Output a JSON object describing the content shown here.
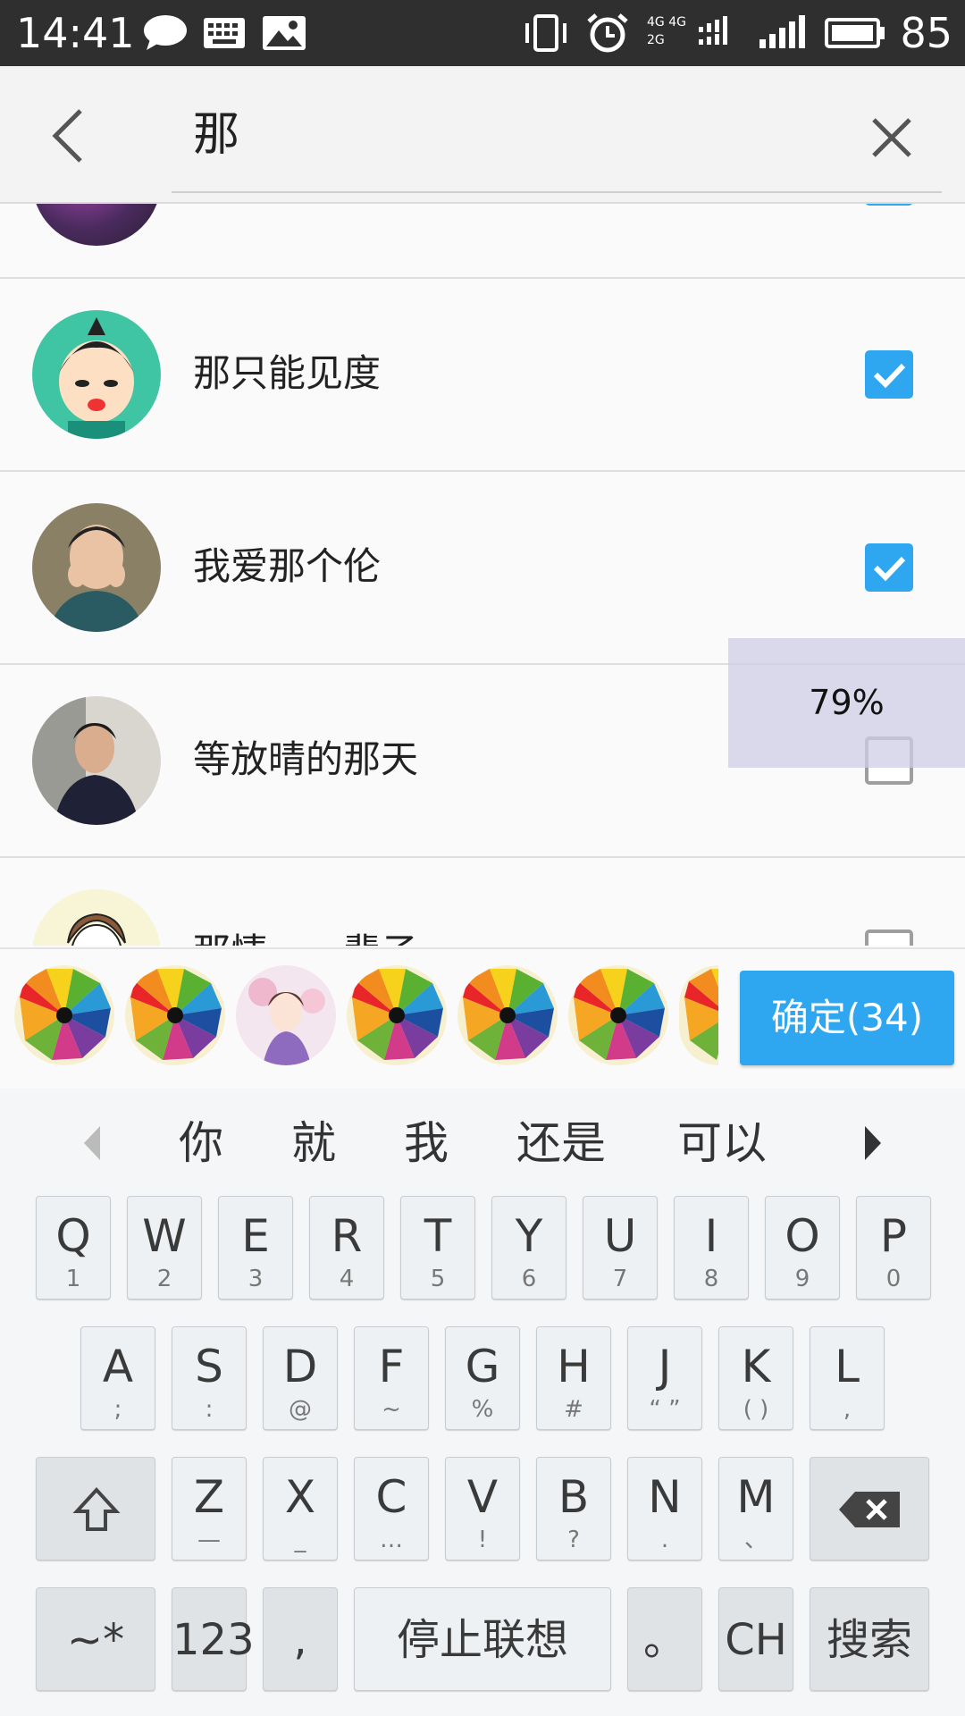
{
  "status_bar": {
    "time": "14:41",
    "network_top": "4G 4G",
    "network_bottom": "2G",
    "battery": "85"
  },
  "search": {
    "query": "那"
  },
  "contacts": [
    {
      "name": "",
      "checked": true
    },
    {
      "name": "那只能见度",
      "checked": true
    },
    {
      "name": "我爱那个伦",
      "checked": true
    },
    {
      "name": "等放晴的那天",
      "checked": false
    },
    {
      "name": "那情……辈子",
      "checked": false
    }
  ],
  "scroll_overlay": {
    "text": "79%"
  },
  "selected": {
    "confirm_label": "确定(34)"
  },
  "keyboard": {
    "candidates": [
      "你",
      "就",
      "我",
      "还是",
      "可以"
    ],
    "row1": [
      {
        "main": "Q",
        "sub": "1"
      },
      {
        "main": "W",
        "sub": "2"
      },
      {
        "main": "E",
        "sub": "3"
      },
      {
        "main": "R",
        "sub": "4"
      },
      {
        "main": "T",
        "sub": "5"
      },
      {
        "main": "Y",
        "sub": "6"
      },
      {
        "main": "U",
        "sub": "7"
      },
      {
        "main": "I",
        "sub": "8"
      },
      {
        "main": "O",
        "sub": "9"
      },
      {
        "main": "P",
        "sub": "0"
      }
    ],
    "row2": [
      {
        "main": "A",
        "sub": ";"
      },
      {
        "main": "S",
        "sub": ":"
      },
      {
        "main": "D",
        "sub": "@"
      },
      {
        "main": "F",
        "sub": "~"
      },
      {
        "main": "G",
        "sub": "%"
      },
      {
        "main": "H",
        "sub": "#"
      },
      {
        "main": "J",
        "sub": "“ ”"
      },
      {
        "main": "K",
        "sub": "( )"
      },
      {
        "main": "L",
        "sub": ","
      }
    ],
    "row3": [
      {
        "main": "Z",
        "sub": "—"
      },
      {
        "main": "X",
        "sub": "_"
      },
      {
        "main": "C",
        "sub": "…"
      },
      {
        "main": "V",
        "sub": "!"
      },
      {
        "main": "B",
        "sub": "?"
      },
      {
        "main": "N",
        "sub": "."
      },
      {
        "main": "M",
        "sub": "、"
      }
    ],
    "symbols_label": "~*",
    "numbers_label": "123",
    "comma_label": ",",
    "space_label": "停止联想",
    "period_label": "。",
    "lang_label": "CH",
    "search_label": "搜索"
  }
}
